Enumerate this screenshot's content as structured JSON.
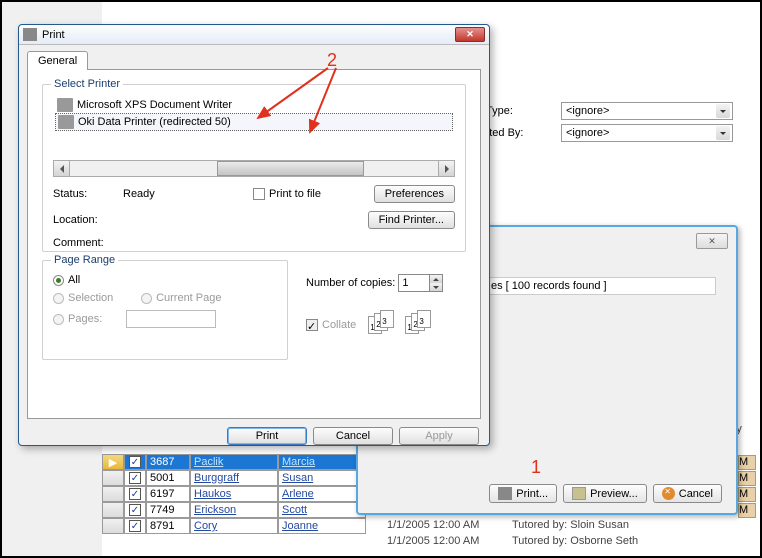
{
  "print": {
    "title": "Print",
    "tab": "General",
    "group_printer": "Select Printer",
    "printers": [
      {
        "name": "Microsoft XPS Document Writer"
      },
      {
        "name": "Oki Data Printer (redirected 50)"
      }
    ],
    "status_label": "Status:",
    "status_value": "Ready",
    "location_label": "Location:",
    "comment_label": "Comment:",
    "print_to_file": "Print to file",
    "preferences": "Preferences",
    "find_printer": "Find Printer...",
    "group_range": "Page Range",
    "all": "All",
    "selection": "Selection",
    "current_page": "Current Page",
    "pages": "Pages:",
    "copies_label": "Number of copies:",
    "copies_value": "1",
    "collate": "Collate",
    "btn_print": "Print",
    "btn_cancel": "Cancel",
    "btn_apply": "Apply"
  },
  "bg": {
    "type_label": "g Type:",
    "type_value": "<ignore>",
    "created_label": "eated By:",
    "created_value": "<ignore>",
    "records_suffix": "es [ 100 records found ]",
    "by_label": "By",
    "print": "Print...",
    "preview": "Preview...",
    "cancel": "Cancel",
    "extra_date": "1/1/2005 12:00 AM",
    "extra_tutor1": "Tutored by: Sloin Susan",
    "extra_tutor2": "Tutored by: Osborne Seth"
  },
  "grid": {
    "rows": [
      {
        "id": "3687",
        "last": "Paclik",
        "first": "Marcia",
        "selected": true,
        "marker": "▶"
      },
      {
        "id": "5001",
        "last": "Burggraff",
        "first": "Susan",
        "selected": false
      },
      {
        "id": "6197",
        "last": "Haukos",
        "first": "Arlene",
        "selected": false
      },
      {
        "id": "7749",
        "last": "Erickson",
        "first": "Scott",
        "selected": false
      },
      {
        "id": "8791",
        "last": "Cory",
        "first": "Joanne",
        "selected": false
      }
    ]
  },
  "annot": {
    "one": "1",
    "two": "2"
  }
}
